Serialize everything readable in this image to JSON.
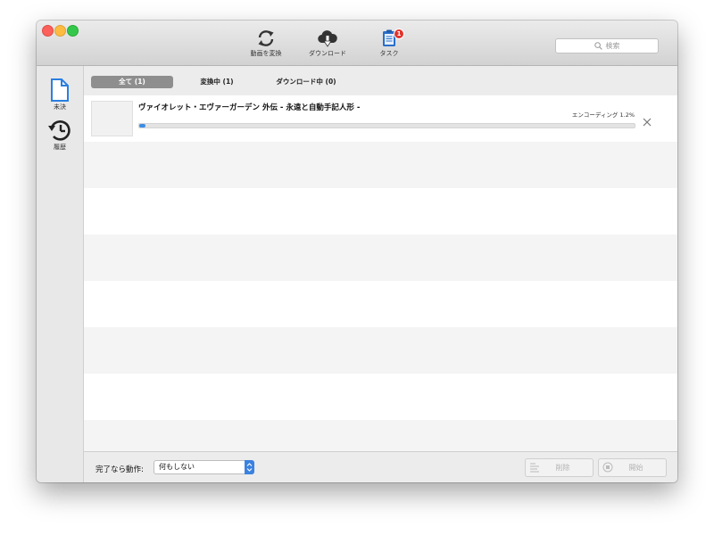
{
  "window": {
    "traffic_lights": {
      "close": "#fc605b",
      "minimize": "#fdbc40",
      "zoom": "#34c84a"
    }
  },
  "toolbar": {
    "convert_label": "動画を変換",
    "download_label": "ダウンロード",
    "tasks_label": "タスク",
    "tasks_badge": "1",
    "search_placeholder": "検索"
  },
  "sidebar": {
    "items": [
      {
        "label": "未決",
        "icon": "document-icon",
        "color": "#2a7fe0"
      },
      {
        "label": "履歴",
        "icon": "history-clock-icon",
        "color": "#222222"
      }
    ]
  },
  "tabs": [
    {
      "label": "全て (1)",
      "active": true
    },
    {
      "label": "変換中 (1)",
      "active": false
    },
    {
      "label": "ダウンロード中 (0)",
      "active": false
    }
  ],
  "task": {
    "title": "ヴァイオレット・エヴァーガーデン 外伝 - 永遠と自動手記人形 -",
    "status": "エンコーディング 1.2%",
    "progress": 0.012
  },
  "footer": {
    "after_label": "完了なら動作:",
    "after_value": "何もしない",
    "delete_label": "削除",
    "start_label": "開始"
  },
  "colors": {
    "accent": "#3b82e0",
    "badge": "#e0332c"
  }
}
